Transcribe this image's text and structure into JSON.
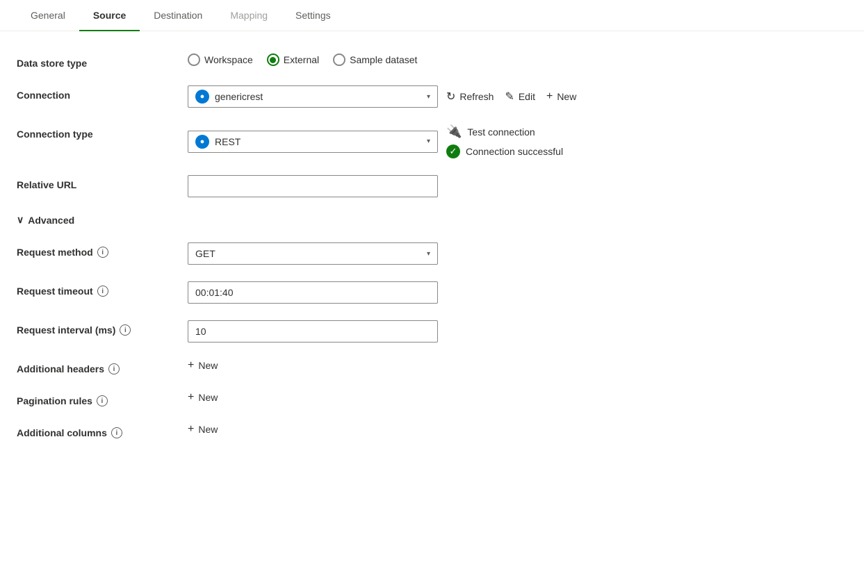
{
  "tabs": [
    {
      "id": "general",
      "label": "General",
      "active": false,
      "disabled": false
    },
    {
      "id": "source",
      "label": "Source",
      "active": true,
      "disabled": false
    },
    {
      "id": "destination",
      "label": "Destination",
      "active": false,
      "disabled": false
    },
    {
      "id": "mapping",
      "label": "Mapping",
      "active": false,
      "disabled": true
    },
    {
      "id": "settings",
      "label": "Settings",
      "active": false,
      "disabled": false
    }
  ],
  "dataStoreType": {
    "label": "Data store type",
    "options": [
      {
        "id": "workspace",
        "label": "Workspace",
        "selected": false
      },
      {
        "id": "external",
        "label": "External",
        "selected": true
      },
      {
        "id": "sample",
        "label": "Sample dataset",
        "selected": false
      }
    ]
  },
  "connection": {
    "label": "Connection",
    "value": "genericrest",
    "refreshLabel": "Refresh",
    "editLabel": "Edit",
    "newLabel": "New"
  },
  "connectionType": {
    "label": "Connection type",
    "value": "REST"
  },
  "testConnection": {
    "label": "Test connection",
    "successLabel": "Connection successful"
  },
  "relativeUrl": {
    "label": "Relative URL",
    "value": "",
    "placeholder": ""
  },
  "advanced": {
    "label": "Advanced",
    "expanded": true
  },
  "requestMethod": {
    "label": "Request method",
    "value": "GET"
  },
  "requestTimeout": {
    "label": "Request timeout",
    "value": "00:01:40"
  },
  "requestInterval": {
    "label": "Request interval (ms)",
    "value": "10"
  },
  "additionalHeaders": {
    "label": "Additional headers",
    "newLabel": "New"
  },
  "paginationRules": {
    "label": "Pagination rules",
    "newLabel": "New"
  },
  "additionalColumns": {
    "label": "Additional columns",
    "newLabel": "New"
  },
  "icons": {
    "info": "i",
    "chevronDown": "▾",
    "refresh": "↻",
    "edit": "✎",
    "plus": "+",
    "testPlugin": "🔌",
    "check": "✓",
    "chevronRight": "›",
    "collapse": "∨"
  }
}
